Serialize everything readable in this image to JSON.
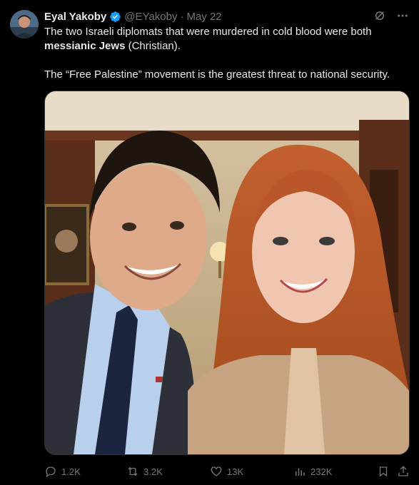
{
  "tweet": {
    "author": {
      "display_name": "Eyal Yakoby",
      "handle": "@EYakoby",
      "verified": true,
      "avatar_icon": "user-avatar"
    },
    "separator": "·",
    "time": "May 22",
    "text_line1_pre": "The two Israeli diplomats that were murdered in cold blood were both ",
    "text_line1_bold": "messianic Jews",
    "text_line1_post": " (Christian).",
    "text_line2": "The “Free Palestine” movement is the greatest threat to national security.",
    "media_alt_icon": "photo-two-people-selfie",
    "actions": {
      "replies": "1.2K",
      "reposts": "3.2K",
      "likes": "13K",
      "views": "232K"
    },
    "icons": {
      "grok": "grok-icon",
      "more": "more-icon",
      "reply": "reply-icon",
      "repost": "repost-icon",
      "like": "heart-icon",
      "views": "views-chart-icon",
      "bookmark": "bookmark-icon",
      "share": "share-icon"
    },
    "colors": {
      "background": "#000000",
      "text": "#e7e9ea",
      "muted": "#71767b",
      "verified": "#1d9bf0"
    }
  }
}
